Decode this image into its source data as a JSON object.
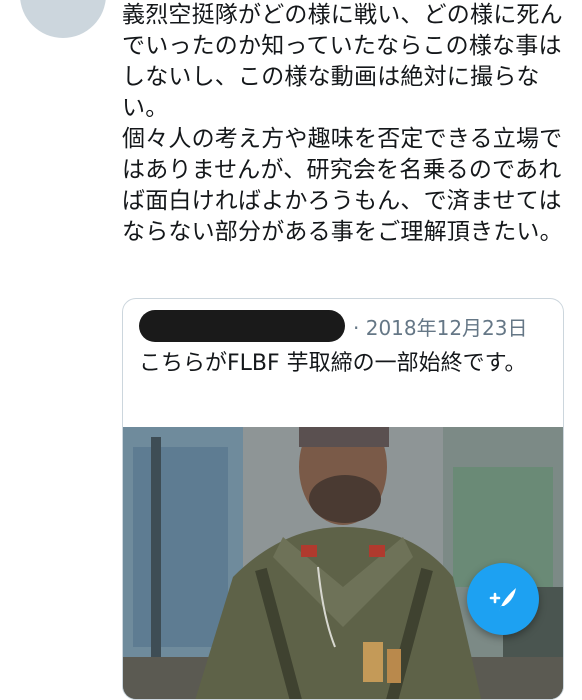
{
  "tweet": {
    "text": "義烈空挺隊がどの様に戦い、どの様に死んでいったのか知っていたならこの様な事はしないし、この様な動画は絶対に撮らない。\n個々人の考え方や趣味を否定できる立場ではありませんが、研究会を名乗るのであれば面白ければよかろうもん、で済ませてはならない部分がある事をご理解頂きたい。"
  },
  "quote": {
    "date": "· 2018年12月23日",
    "text": "こちらがFLBF 芋取締の一部始終です。"
  },
  "compose_button": {
    "icon": "compose-feather-icon",
    "color": "#1da1f2"
  }
}
